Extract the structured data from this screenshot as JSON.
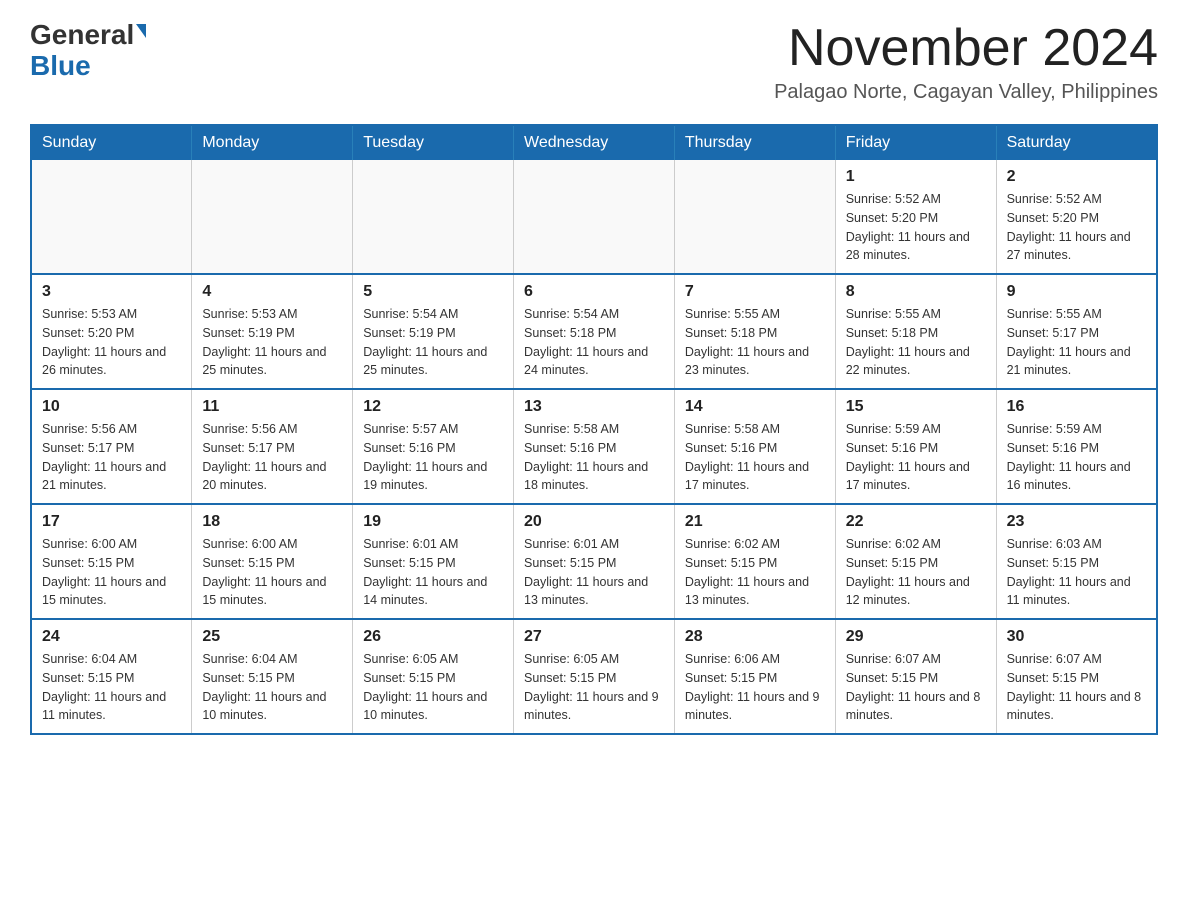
{
  "logo": {
    "general": "General",
    "blue": "Blue"
  },
  "title": "November 2024",
  "location": "Palagao Norte, Cagayan Valley, Philippines",
  "days_of_week": [
    "Sunday",
    "Monday",
    "Tuesday",
    "Wednesday",
    "Thursday",
    "Friday",
    "Saturday"
  ],
  "weeks": [
    [
      {
        "day": "",
        "info": ""
      },
      {
        "day": "",
        "info": ""
      },
      {
        "day": "",
        "info": ""
      },
      {
        "day": "",
        "info": ""
      },
      {
        "day": "",
        "info": ""
      },
      {
        "day": "1",
        "info": "Sunrise: 5:52 AM\nSunset: 5:20 PM\nDaylight: 11 hours and 28 minutes."
      },
      {
        "day": "2",
        "info": "Sunrise: 5:52 AM\nSunset: 5:20 PM\nDaylight: 11 hours and 27 minutes."
      }
    ],
    [
      {
        "day": "3",
        "info": "Sunrise: 5:53 AM\nSunset: 5:20 PM\nDaylight: 11 hours and 26 minutes."
      },
      {
        "day": "4",
        "info": "Sunrise: 5:53 AM\nSunset: 5:19 PM\nDaylight: 11 hours and 25 minutes."
      },
      {
        "day": "5",
        "info": "Sunrise: 5:54 AM\nSunset: 5:19 PM\nDaylight: 11 hours and 25 minutes."
      },
      {
        "day": "6",
        "info": "Sunrise: 5:54 AM\nSunset: 5:18 PM\nDaylight: 11 hours and 24 minutes."
      },
      {
        "day": "7",
        "info": "Sunrise: 5:55 AM\nSunset: 5:18 PM\nDaylight: 11 hours and 23 minutes."
      },
      {
        "day": "8",
        "info": "Sunrise: 5:55 AM\nSunset: 5:18 PM\nDaylight: 11 hours and 22 minutes."
      },
      {
        "day": "9",
        "info": "Sunrise: 5:55 AM\nSunset: 5:17 PM\nDaylight: 11 hours and 21 minutes."
      }
    ],
    [
      {
        "day": "10",
        "info": "Sunrise: 5:56 AM\nSunset: 5:17 PM\nDaylight: 11 hours and 21 minutes."
      },
      {
        "day": "11",
        "info": "Sunrise: 5:56 AM\nSunset: 5:17 PM\nDaylight: 11 hours and 20 minutes."
      },
      {
        "day": "12",
        "info": "Sunrise: 5:57 AM\nSunset: 5:16 PM\nDaylight: 11 hours and 19 minutes."
      },
      {
        "day": "13",
        "info": "Sunrise: 5:58 AM\nSunset: 5:16 PM\nDaylight: 11 hours and 18 minutes."
      },
      {
        "day": "14",
        "info": "Sunrise: 5:58 AM\nSunset: 5:16 PM\nDaylight: 11 hours and 17 minutes."
      },
      {
        "day": "15",
        "info": "Sunrise: 5:59 AM\nSunset: 5:16 PM\nDaylight: 11 hours and 17 minutes."
      },
      {
        "day": "16",
        "info": "Sunrise: 5:59 AM\nSunset: 5:16 PM\nDaylight: 11 hours and 16 minutes."
      }
    ],
    [
      {
        "day": "17",
        "info": "Sunrise: 6:00 AM\nSunset: 5:15 PM\nDaylight: 11 hours and 15 minutes."
      },
      {
        "day": "18",
        "info": "Sunrise: 6:00 AM\nSunset: 5:15 PM\nDaylight: 11 hours and 15 minutes."
      },
      {
        "day": "19",
        "info": "Sunrise: 6:01 AM\nSunset: 5:15 PM\nDaylight: 11 hours and 14 minutes."
      },
      {
        "day": "20",
        "info": "Sunrise: 6:01 AM\nSunset: 5:15 PM\nDaylight: 11 hours and 13 minutes."
      },
      {
        "day": "21",
        "info": "Sunrise: 6:02 AM\nSunset: 5:15 PM\nDaylight: 11 hours and 13 minutes."
      },
      {
        "day": "22",
        "info": "Sunrise: 6:02 AM\nSunset: 5:15 PM\nDaylight: 11 hours and 12 minutes."
      },
      {
        "day": "23",
        "info": "Sunrise: 6:03 AM\nSunset: 5:15 PM\nDaylight: 11 hours and 11 minutes."
      }
    ],
    [
      {
        "day": "24",
        "info": "Sunrise: 6:04 AM\nSunset: 5:15 PM\nDaylight: 11 hours and 11 minutes."
      },
      {
        "day": "25",
        "info": "Sunrise: 6:04 AM\nSunset: 5:15 PM\nDaylight: 11 hours and 10 minutes."
      },
      {
        "day": "26",
        "info": "Sunrise: 6:05 AM\nSunset: 5:15 PM\nDaylight: 11 hours and 10 minutes."
      },
      {
        "day": "27",
        "info": "Sunrise: 6:05 AM\nSunset: 5:15 PM\nDaylight: 11 hours and 9 minutes."
      },
      {
        "day": "28",
        "info": "Sunrise: 6:06 AM\nSunset: 5:15 PM\nDaylight: 11 hours and 9 minutes."
      },
      {
        "day": "29",
        "info": "Sunrise: 6:07 AM\nSunset: 5:15 PM\nDaylight: 11 hours and 8 minutes."
      },
      {
        "day": "30",
        "info": "Sunrise: 6:07 AM\nSunset: 5:15 PM\nDaylight: 11 hours and 8 minutes."
      }
    ]
  ]
}
